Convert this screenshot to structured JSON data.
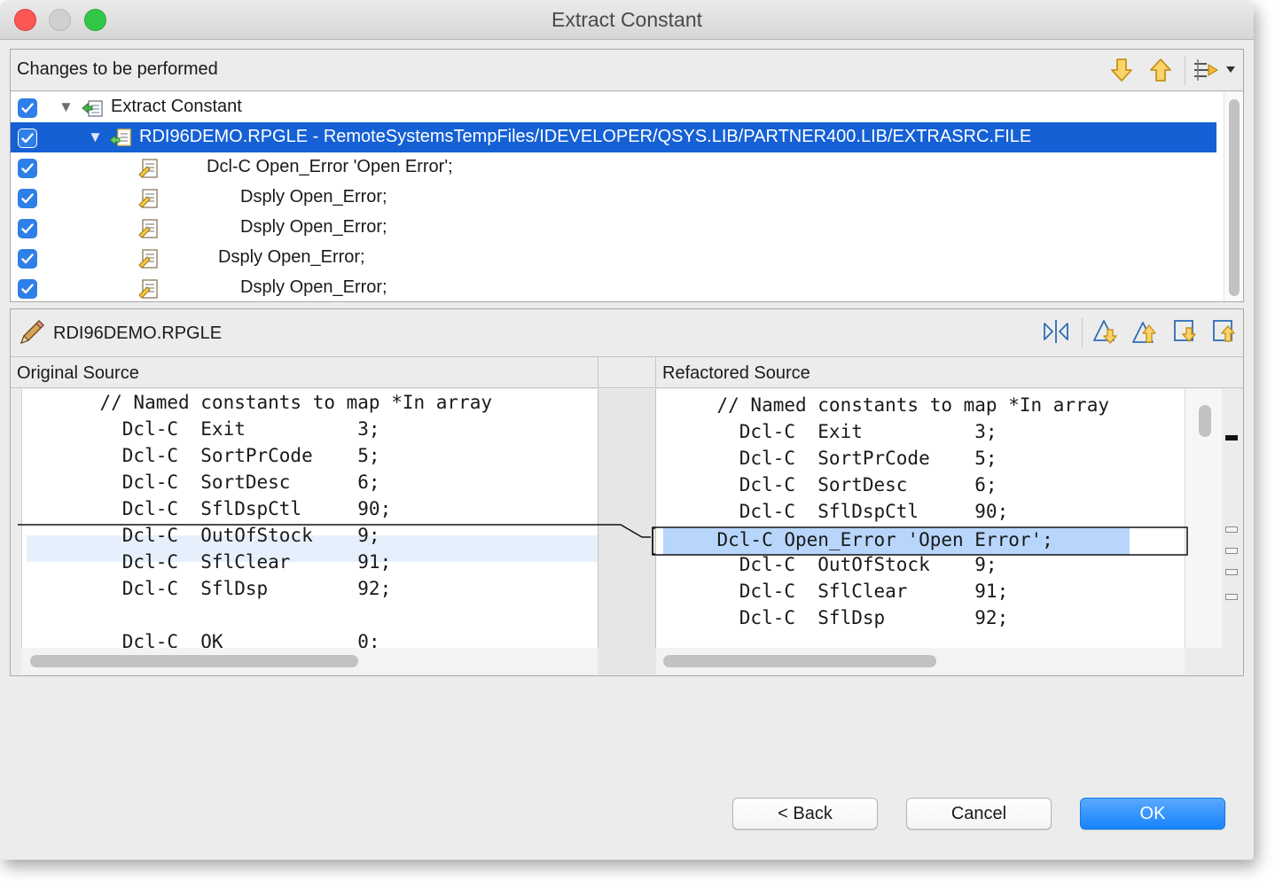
{
  "window": {
    "title": "Extract Constant"
  },
  "changes": {
    "title": "Changes to be performed",
    "toolbar_icons": [
      "next-change-icon",
      "previous-change-icon",
      "filter-changes-icon",
      "dropdown-arrow-icon"
    ],
    "tree": [
      {
        "checked": true,
        "expanded": true,
        "icon": "refactoring-change-icon",
        "label": "Extract Constant"
      },
      {
        "checked": true,
        "expanded": true,
        "icon": "file-change-icon",
        "label": "RDI96DEMO.RPGLE - RemoteSystemsTempFiles/IDEVELOPER/QSYS.LIB/PARTNER400.LIB/EXTRASRC.FILE",
        "selected": true
      },
      {
        "checked": true,
        "icon": "text-edit-icon",
        "label": "Dcl-C Open_Error 'Open Error';"
      },
      {
        "checked": true,
        "icon": "text-edit-icon",
        "label": "Dsply Open_Error;"
      },
      {
        "checked": true,
        "icon": "text-edit-icon",
        "label": "Dsply Open_Error;"
      },
      {
        "checked": true,
        "icon": "text-edit-icon",
        "label": "Dsply Open_Error;"
      },
      {
        "checked": true,
        "icon": "text-edit-icon",
        "label": "Dsply Open_Error;"
      }
    ]
  },
  "compare": {
    "file_icon": "pencil-icon",
    "file_name": "RDI96DEMO.RPGLE",
    "toolbar_icons": [
      "swap-sides-icon",
      "next-difference-icon",
      "previous-difference-icon",
      "next-change-icon",
      "previous-change-icon"
    ],
    "left_title": "Original Source",
    "right_title": "Refactored Source",
    "left_lines": [
      "       // Named constants to map *In array",
      "         Dcl-C  Exit          3;",
      "         Dcl-C  SortPrCode    5;",
      "         Dcl-C  SortDesc      6;",
      "         Dcl-C  SflDspCtl     90;",
      "         Dcl-C  OutOfStock    9;",
      "         Dcl-C  SflClear      91;",
      "         Dcl-C  SflDsp        92;",
      "",
      "         Dcl-C  OK            0;"
    ],
    "right_lines": [
      "       // Named constants to map *In array",
      "         Dcl-C  Exit          3;",
      "         Dcl-C  SortPrCode    5;",
      "         Dcl-C  SortDesc      6;",
      "         Dcl-C  SflDspCtl     90;",
      "       Dcl-C Open_Error 'Open Error';",
      "         Dcl-C  OutOfStock    9;",
      "         Dcl-C  SflClear      91;",
      "         Dcl-C  SflDsp        92;"
    ],
    "highlight_color": "#b8d6fb"
  },
  "buttons": {
    "back": "< Back",
    "cancel": "Cancel",
    "ok": "OK"
  },
  "colors": {
    "selection": "#1560d4",
    "primary_button": "#1683fb",
    "checkbox": "#2f7fe8"
  }
}
